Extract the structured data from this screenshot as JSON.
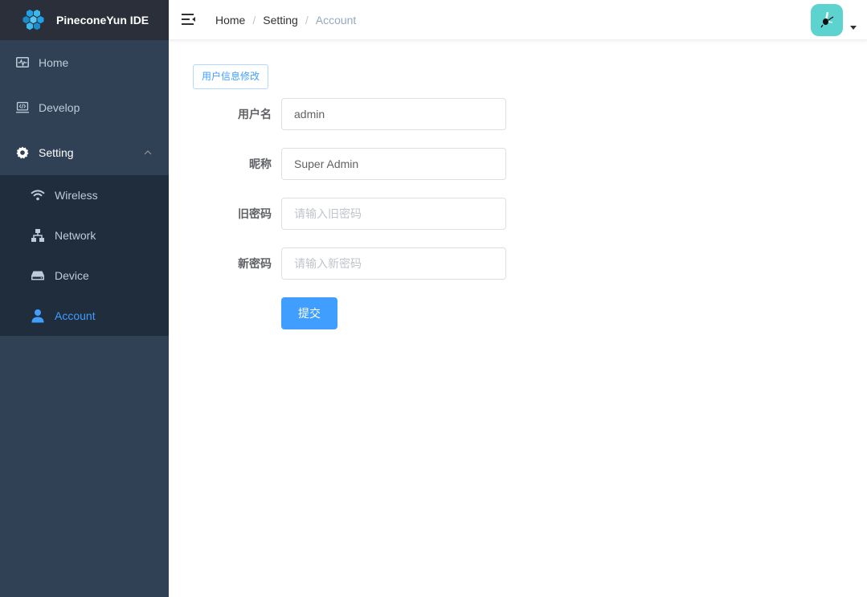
{
  "app": {
    "title": "PineconeYun IDE"
  },
  "sidebar": {
    "items": [
      {
        "label": "Home",
        "icon": "pulse-monitor-icon"
      },
      {
        "label": "Develop",
        "icon": "code-monitor-icon"
      },
      {
        "label": "Setting",
        "icon": "gear-icon",
        "expanded": true
      }
    ],
    "subitems": [
      {
        "label": "Wireless",
        "icon": "wifi-icon"
      },
      {
        "label": "Network",
        "icon": "network-icon"
      },
      {
        "label": "Device",
        "icon": "drive-icon"
      },
      {
        "label": "Account",
        "icon": "user-icon",
        "active": true
      }
    ]
  },
  "breadcrumb": {
    "home": "Home",
    "setting": "Setting",
    "current": "Account",
    "separator": "/"
  },
  "colors": {
    "sidebar": "#304156",
    "submenu": "#1f2d3d",
    "accent": "#409eff",
    "avatar": "#5cd3cf"
  },
  "form": {
    "section_button": "用户信息修改",
    "username": {
      "label": "用户名",
      "value": "admin"
    },
    "nickname": {
      "label": "昵称",
      "value": "Super Admin"
    },
    "old_password": {
      "label": "旧密码",
      "placeholder": "请输入旧密码"
    },
    "new_password": {
      "label": "新密码",
      "placeholder": "请输入新密码"
    },
    "submit": "提交"
  }
}
